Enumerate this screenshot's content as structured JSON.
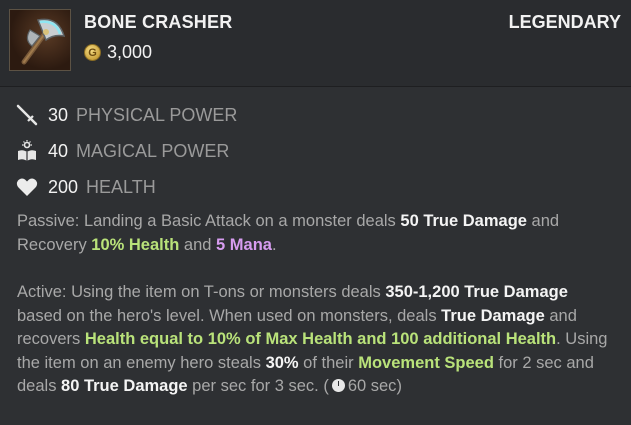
{
  "item": {
    "name": "BONE CRASHER",
    "rarity": "LEGENDARY",
    "price": "3,000",
    "currency_symbol": "G",
    "icon": "axe-icon"
  },
  "stats": [
    {
      "icon": "sword-icon",
      "value": "30",
      "label": "PHYSICAL POWER"
    },
    {
      "icon": "magic-book-icon",
      "value": "40",
      "label": "MAGICAL POWER"
    },
    {
      "icon": "heart-icon",
      "value": "200",
      "label": "HEALTH"
    }
  ],
  "passive": {
    "t1": "Passive: Landing a Basic Attack on a monster deals ",
    "h1": "50 True Damage",
    "t2": " and Recovery ",
    "h2": "10% Health",
    "t3": " and ",
    "h3": "5 Mana",
    "t4": "."
  },
  "active": {
    "t1": "Active: Using the item on T-ons or monsters deals ",
    "h1": "350-1,200 True Damage",
    "t2": " based on the hero's level. When used on monsters, deals ",
    "h2": "True Damage",
    "t3": " and recovers ",
    "h3": "Health equal to 10% of Max Health and 100 additional Health",
    "t4": ". Using the item on an enemy hero steals ",
    "h4": "30%",
    "t5": " of their ",
    "h5": "Movement Speed",
    "t6": " for 2 sec and deals ",
    "h6": "80 True Damage",
    "t7": " per sec for 3 sec. (",
    "cooldown": "60 sec",
    "t8": ")"
  },
  "colors": {
    "highlight_white": "#f4f4f4",
    "highlight_green": "#b9e27a",
    "highlight_purple": "#d79cf0",
    "body_text": "#a8a8a8"
  }
}
